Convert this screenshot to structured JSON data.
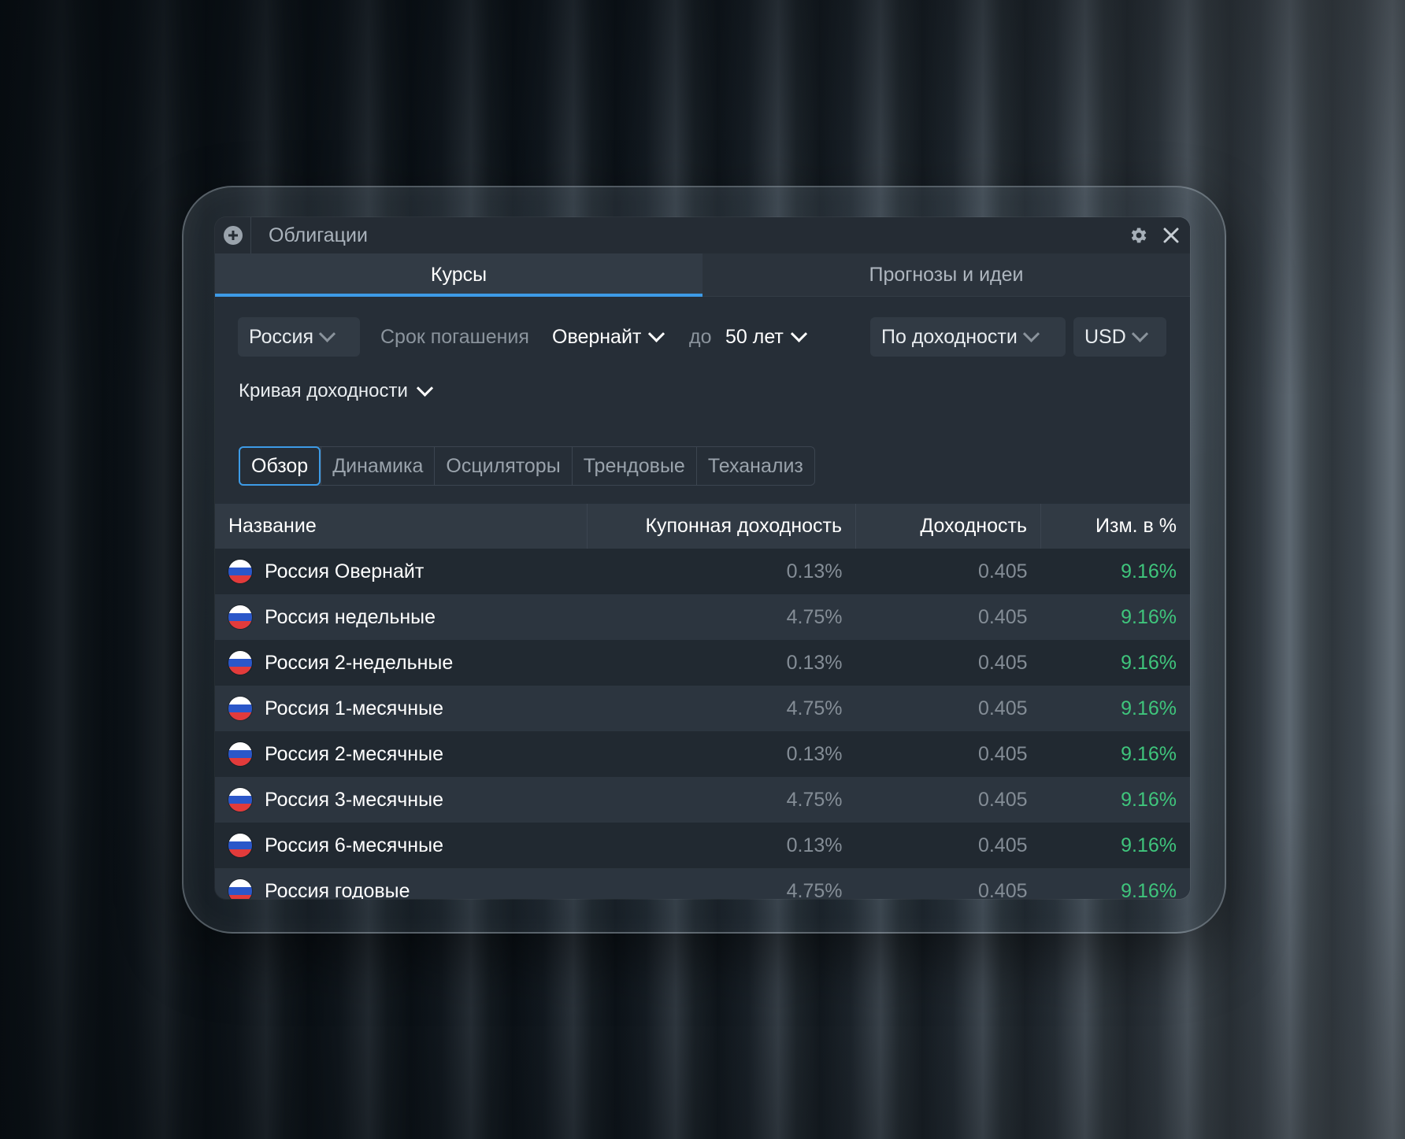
{
  "window": {
    "title": "Облигации"
  },
  "tabs": [
    {
      "label": "Курсы",
      "active": true
    },
    {
      "label": "Прогнозы и идеи",
      "active": false
    }
  ],
  "filters": {
    "country": "Россия",
    "maturity_label": "Срок погашения",
    "maturity_from": "Овернайт",
    "to_label": "до",
    "maturity_to": "50 лет",
    "sort": "По доходности",
    "currency": "USD"
  },
  "view_selector": "Кривая доходности",
  "segments": [
    "Обзор",
    "Динамика",
    "Осциляторы",
    "Трендовые",
    "Теханализ"
  ],
  "table": {
    "columns": [
      "Название",
      "Купонная доходность",
      "Доходность",
      "Изм. в %"
    ],
    "rows": [
      {
        "name": "Россия Овернайт",
        "coupon": "0.13%",
        "yield": "0.405",
        "change": "9.16%"
      },
      {
        "name": "Россия недельные",
        "coupon": "4.75%",
        "yield": "0.405",
        "change": "9.16%"
      },
      {
        "name": "Россия 2-недельные",
        "coupon": "0.13%",
        "yield": "0.405",
        "change": "9.16%"
      },
      {
        "name": "Россия 1-месячные",
        "coupon": "4.75%",
        "yield": "0.405",
        "change": "9.16%"
      },
      {
        "name": "Россия 2-месячные",
        "coupon": "0.13%",
        "yield": "0.405",
        "change": "9.16%"
      },
      {
        "name": "Россия 3-месячные",
        "coupon": "4.75%",
        "yield": "0.405",
        "change": "9.16%"
      },
      {
        "name": "Россия 6-месячные",
        "coupon": "0.13%",
        "yield": "0.405",
        "change": "9.16%"
      },
      {
        "name": "Россия годовые",
        "coupon": "4.75%",
        "yield": "0.405",
        "change": "9.16%"
      }
    ]
  },
  "colors": {
    "accent": "#3d9be6",
    "positive": "#3fc57c",
    "window_bg": "#262e37"
  },
  "icons": [
    "plus-circle-icon",
    "gear-icon",
    "close-icon",
    "chevron-down-icon",
    "russia-flag-icon"
  ]
}
